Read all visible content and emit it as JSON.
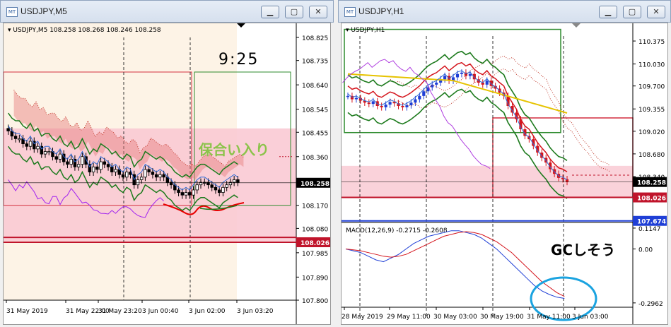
{
  "windows": [
    {
      "title": "USDJPY,M5",
      "chart_data": {
        "type": "candlestick",
        "symbol": "USDJPY,M5",
        "header": "USDJPY,M5  108.258 108.268 108.246 108.258",
        "y_ticks": [
          "108.825",
          "108.735",
          "108.640",
          "108.545",
          "108.455",
          "108.360",
          "108.265",
          "108.170",
          "108.080",
          "107.985",
          "107.890",
          "107.800"
        ],
        "ylim": [
          107.8,
          108.85
        ],
        "x_ticks": [
          "31 May 2019",
          "31 May 22:00",
          "31 May 23:20",
          "3 Jun 00:40",
          "3 Jun 02:00",
          "3 Jun 03:20"
        ],
        "price_label": "108.258",
        "level_label": "108.026",
        "annotations": [
          "9:25",
          "保合い入り"
        ],
        "close": [
          108.46,
          108.44,
          108.43,
          108.43,
          108.41,
          108.4,
          108.42,
          108.39,
          108.4,
          108.37,
          108.38,
          108.38,
          108.36,
          108.35,
          108.37,
          108.34,
          108.33,
          108.35,
          108.32,
          108.33,
          108.36,
          108.33,
          108.3,
          108.32,
          108.31,
          108.34,
          108.33,
          108.32,
          108.3,
          108.31,
          108.29,
          108.28,
          108.3,
          108.29,
          108.25,
          108.27,
          108.28,
          108.31,
          108.3,
          108.29,
          108.28,
          108.29,
          108.28,
          108.26,
          108.25,
          108.23,
          108.22,
          108.21,
          108.22,
          108.21,
          108.23,
          108.25,
          108.26,
          108.26,
          108.25,
          108.24,
          108.23,
          108.22,
          108.24,
          108.25,
          108.26,
          108.27,
          108.26
        ]
      }
    },
    {
      "title": "USDJPY,H1",
      "chart_data": {
        "type": "candlestick",
        "symbol": "USDJPY,H1",
        "header": "USDJPY,H1",
        "y_ticks": [
          "110.375",
          "110.030",
          "109.700",
          "109.355",
          "109.020",
          "108.680",
          "108.340"
        ],
        "ylim": [
          107.65,
          110.45
        ],
        "x_ticks": [
          "28 May 2019",
          "29 May 11:00",
          "30 May 03:00",
          "30 May 19:00",
          "31 May 11:00",
          "3 Jun 03:00"
        ],
        "price_label": "108.258",
        "level_label_red": "108.026",
        "level_label_blue": "107.674",
        "macd": {
          "label": "MACD(12,26,9) -0.2715 -0.2608",
          "y_ticks": [
            "0.1147",
            "0.00",
            "-0.2962"
          ],
          "ylim": [
            -0.32,
            0.13
          ],
          "main": [
            0.0,
            -0.01,
            -0.02,
            -0.04,
            -0.06,
            -0.07,
            -0.05,
            -0.03,
            0.0,
            0.03,
            0.05,
            0.07,
            0.08,
            0.09,
            0.1,
            0.1,
            0.09,
            0.08,
            0.06,
            0.03,
            0.0,
            -0.04,
            -0.08,
            -0.12,
            -0.16,
            -0.2,
            -0.23,
            -0.25,
            -0.265,
            -0.2715
          ],
          "signal": [
            0.0,
            -0.005,
            -0.01,
            -0.02,
            -0.03,
            -0.04,
            -0.045,
            -0.04,
            -0.03,
            -0.01,
            0.01,
            0.03,
            0.05,
            0.07,
            0.08,
            0.09,
            0.095,
            0.09,
            0.08,
            0.06,
            0.04,
            0.01,
            -0.02,
            -0.06,
            -0.1,
            -0.14,
            -0.18,
            -0.21,
            -0.24,
            -0.2608
          ]
        },
        "annotations": [
          "GCしそう"
        ],
        "close": [
          109.55,
          109.5,
          109.52,
          109.48,
          109.45,
          109.43,
          109.47,
          109.4,
          109.38,
          109.42,
          109.46,
          109.44,
          109.4,
          109.38,
          109.41,
          109.45,
          109.5,
          109.55,
          109.62,
          109.68,
          109.72,
          109.75,
          109.8,
          109.85,
          109.78,
          109.83,
          109.88,
          109.9,
          109.85,
          109.88,
          109.8,
          109.75,
          109.72,
          109.78,
          109.7,
          109.66,
          109.6,
          109.55,
          109.4,
          109.3,
          109.2,
          109.05,
          108.95,
          108.9,
          108.8,
          108.7,
          108.62,
          108.55,
          108.45,
          108.38,
          108.32,
          108.3,
          108.26
        ]
      }
    }
  ]
}
